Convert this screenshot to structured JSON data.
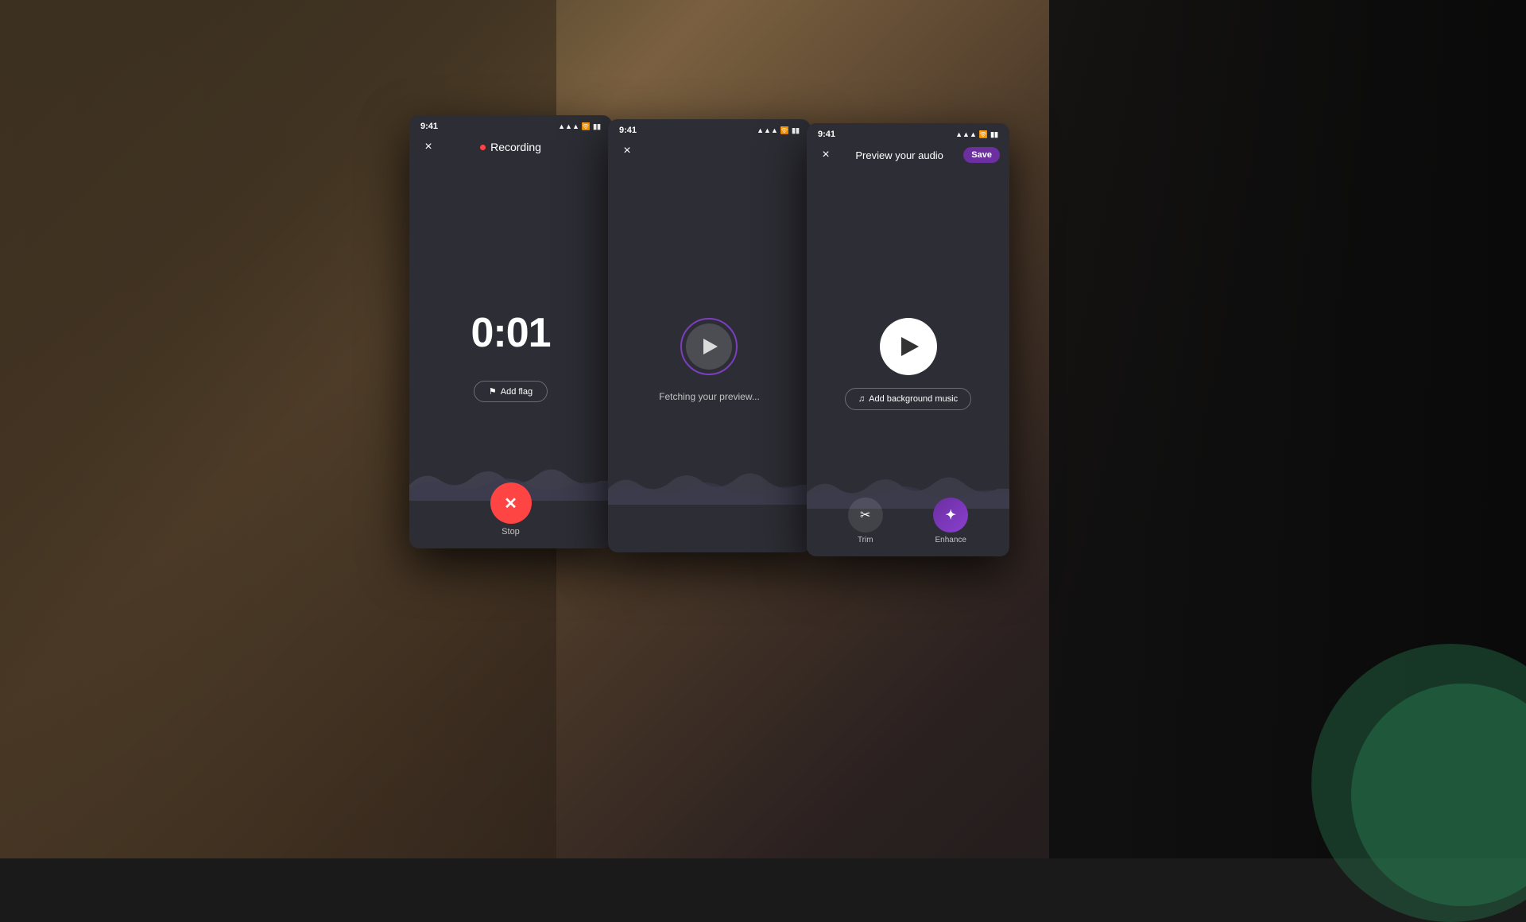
{
  "background": {
    "color": "#2a2015"
  },
  "phone1": {
    "status_time": "9:41",
    "nav_title": "Recording",
    "close_label": "×",
    "timer": "0:01",
    "add_flag_label": "Add flag",
    "stop_label": "Stop",
    "recording_indicator": "●"
  },
  "phone2": {
    "status_time": "9:41",
    "close_label": "×",
    "fetching_text": "Fetching your preview..."
  },
  "phone3": {
    "status_time": "9:41",
    "nav_title": "Preview your audio",
    "close_label": "×",
    "save_label": "Save",
    "add_music_label": "Add background music",
    "trim_label": "Trim",
    "enhance_label": "Enhance",
    "music_icon": "♫",
    "scissors_icon": "✂",
    "enhance_icon": "✦"
  },
  "colors": {
    "phone_bg": "#2d2d35",
    "recording_red": "#ff4444",
    "purple_accent": "#6b2fa0",
    "white": "#ffffff",
    "text_muted": "rgba(255,255,255,0.7)"
  }
}
